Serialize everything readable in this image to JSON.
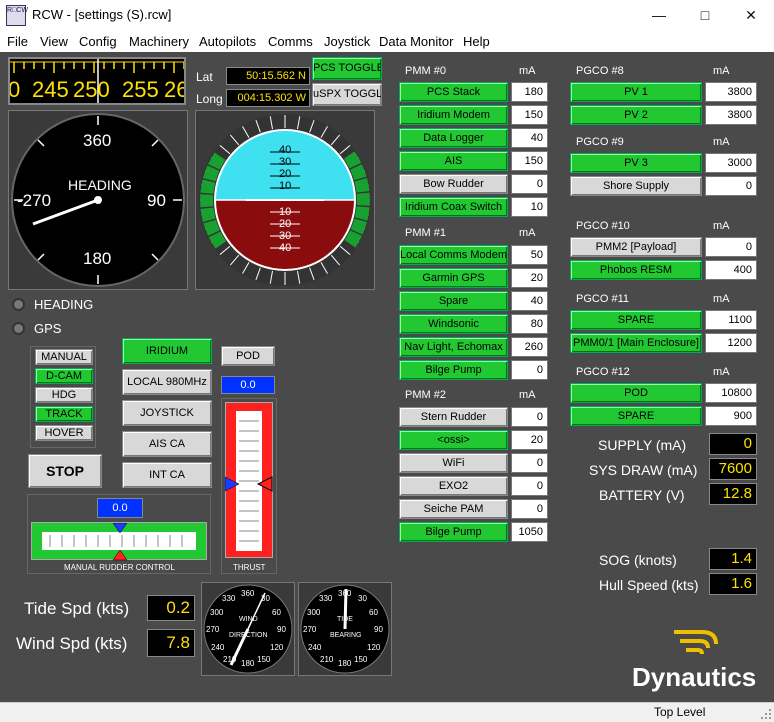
{
  "window": {
    "title": "RCW - [settings (S).rcw]",
    "icon_text": "R□CW",
    "minimize": "—",
    "maximize": "□",
    "close": "✕"
  },
  "menu": [
    "File",
    "View",
    "Config",
    "Machinery",
    "Autopilots",
    "Comms",
    "Joystick",
    "Data Monitor",
    "Help"
  ],
  "nav": {
    "tape_numbers": [
      "0",
      "245",
      "250",
      "255",
      "26"
    ],
    "lat_label": "Lat",
    "long_label": "Long",
    "lat_value": "50:15.562 N",
    "long_value": "004:15.302 W",
    "pcs_toggle": "PCS TOGGLE",
    "uspx_toggle": "uSPX TOGGLE",
    "heading_title": "HEADING",
    "heading_value": 248,
    "compass": {
      "n": "360",
      "e": "90",
      "s": "180",
      "w": "-270"
    },
    "attitude_up": [
      "40",
      "30",
      "20",
      "10"
    ],
    "attitude_down": [
      "10",
      "20",
      "30",
      "40"
    ]
  },
  "sources": {
    "heading": "HEADING",
    "gps": "GPS"
  },
  "modes": [
    "MANUAL",
    "D-CAM",
    "HDG",
    "TRACK",
    "HOVER"
  ],
  "modes_active": [
    "D-CAM",
    "TRACK"
  ],
  "stop": "STOP",
  "comms": [
    {
      "label": "IRIDIUM",
      "active": true
    },
    {
      "label": "LOCAL 980MHz",
      "active": false
    },
    {
      "label": "JOYSTICK",
      "active": false
    },
    {
      "label": "AIS CA",
      "active": false
    },
    {
      "label": "INT CA",
      "active": false
    }
  ],
  "pod": {
    "label": "POD",
    "value": "0.0",
    "thrust_label": "THRUST"
  },
  "rudder": {
    "value": "0.0",
    "label": "MANUAL RUDDER CONTROL"
  },
  "env": {
    "tide_label": "Tide Spd (kts)",
    "tide_value": "0.2",
    "wind_label": "Wind Spd (kts)",
    "wind_value": "7.8"
  },
  "dials": {
    "wind": {
      "label": "WIND",
      "sub": "DIRECTION"
    },
    "tide": {
      "label": "TIDE",
      "sub": "BEARING"
    },
    "ticks": [
      "360",
      "30",
      "60",
      "90",
      "120",
      "150",
      "180",
      "210",
      "240",
      "270",
      "300",
      "330"
    ]
  },
  "ma_label": "mA",
  "pmm0": {
    "title": "PMM #0",
    "items": [
      {
        "label": "PCS Stack",
        "value": "180",
        "on": true
      },
      {
        "label": "Iridium Modem",
        "value": "150",
        "on": true
      },
      {
        "label": "Data Logger",
        "value": "40",
        "on": true
      },
      {
        "label": "AIS",
        "value": "150",
        "on": true
      },
      {
        "label": "Bow Rudder",
        "value": "0",
        "on": false
      },
      {
        "label": "Iridium Coax Switch",
        "value": "10",
        "on": true
      }
    ]
  },
  "pmm1": {
    "title": "PMM #1",
    "items": [
      {
        "label": "Local Comms Modems",
        "value": "50",
        "on": true
      },
      {
        "label": "Garmin GPS",
        "value": "20",
        "on": true
      },
      {
        "label": "Spare",
        "value": "40",
        "on": true
      },
      {
        "label": "Windsonic",
        "value": "80",
        "on": true
      },
      {
        "label": "Nav Light, Echomax",
        "value": "260",
        "on": true
      },
      {
        "label": "Bilge Pump",
        "value": "0",
        "on": true
      }
    ]
  },
  "pmm2": {
    "title": "PMM #2",
    "items": [
      {
        "label": "Stern Rudder",
        "value": "0",
        "on": false
      },
      {
        "label": "<ossi>",
        "value": "20",
        "on": true
      },
      {
        "label": "WiFi",
        "value": "0",
        "on": false
      },
      {
        "label": "EXO2",
        "value": "0",
        "on": false
      },
      {
        "label": "Seiche PAM",
        "value": "0",
        "on": false
      },
      {
        "label": "Bilge Pump",
        "value": "1050",
        "on": true
      }
    ]
  },
  "pgco8": {
    "title": "PGCO #8",
    "items": [
      {
        "label": "PV 1",
        "value": "3800",
        "on": true
      },
      {
        "label": "PV 2",
        "value": "3800",
        "on": true
      }
    ]
  },
  "pgco9": {
    "title": "PGCO #9",
    "items": [
      {
        "label": "PV 3",
        "value": "3000",
        "on": true
      },
      {
        "label": "Shore Supply",
        "value": "0",
        "on": false
      }
    ]
  },
  "pgco10": {
    "title": "PGCO #10",
    "items": [
      {
        "label": "PMM2 [Payload]",
        "value": "0",
        "on": false
      },
      {
        "label": "Phobos RESM",
        "value": "400",
        "on": true
      }
    ]
  },
  "pgco11": {
    "title": "PGCO #11",
    "items": [
      {
        "label": "SPARE",
        "value": "1100",
        "on": true
      },
      {
        "label": "PMM0/1 [Main Enclosure]",
        "value": "1200",
        "on": true
      }
    ]
  },
  "pgco12": {
    "title": "PGCO #12",
    "items": [
      {
        "label": "POD",
        "value": "10800",
        "on": true
      },
      {
        "label": "SPARE",
        "value": "900",
        "on": true
      }
    ]
  },
  "power": {
    "supply_label": "SUPPLY (mA)",
    "supply": "0",
    "draw_label": "SYS DRAW (mA)",
    "draw": "7600",
    "battery_label": "BATTERY (V)",
    "battery": "12.8"
  },
  "speed": {
    "sog_label": "SOG (knots)",
    "sog": "1.4",
    "hull_label": "Hull Speed (kts)",
    "hull": "1.6"
  },
  "logo": "Dynautics",
  "status": "Top Level"
}
